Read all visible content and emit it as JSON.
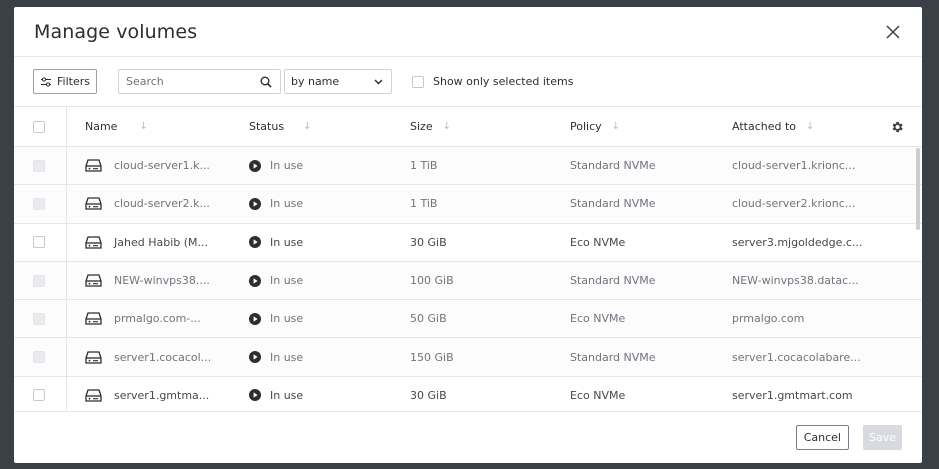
{
  "modal": {
    "title": "Manage volumes",
    "close_icon": "close-icon"
  },
  "toolbar": {
    "filters_label": "Filters",
    "search_placeholder": "Search",
    "search_value": "",
    "sort_value": "by name",
    "show_selected_label": "Show only selected items"
  },
  "table": {
    "columns": {
      "name": "Name",
      "status": "Status",
      "size": "Size",
      "policy": "Policy",
      "attached": "Attached to"
    },
    "rows": [
      {
        "name": "cloud-server1.k...",
        "status": "In use",
        "size": "1 TiB",
        "policy": "Standard NVMe",
        "attached": "cloud-server1.krionc...",
        "disabled": true
      },
      {
        "name": "cloud-server2.k...",
        "status": "In use",
        "size": "1 TiB",
        "policy": "Standard NVMe",
        "attached": "cloud-server2.krionc...",
        "disabled": true
      },
      {
        "name": "Jahed Habib (M...",
        "status": "In use",
        "size": "30 GiB",
        "policy": "Eco NVMe",
        "attached": "server3.mjgoldedge.c...",
        "disabled": false
      },
      {
        "name": "NEW-winvps38....",
        "status": "In use",
        "size": "100 GiB",
        "policy": "Standard NVMe",
        "attached": "NEW-winvps38.datac...",
        "disabled": true
      },
      {
        "name": "prmalgo.com-...",
        "status": "In use",
        "size": "50 GiB",
        "policy": "Eco NVMe",
        "attached": "prmalgo.com",
        "disabled": true
      },
      {
        "name": "server1.cocacol...",
        "status": "In use",
        "size": "150 GiB",
        "policy": "Standard NVMe",
        "attached": "server1.cocacolabare...",
        "disabled": true
      },
      {
        "name": "server1.gmtma...",
        "status": "In use",
        "size": "30 GiB",
        "policy": "Eco NVMe",
        "attached": "server1.gmtmart.com",
        "disabled": false
      }
    ]
  },
  "footer": {
    "cancel_label": "Cancel",
    "save_label": "Save"
  }
}
